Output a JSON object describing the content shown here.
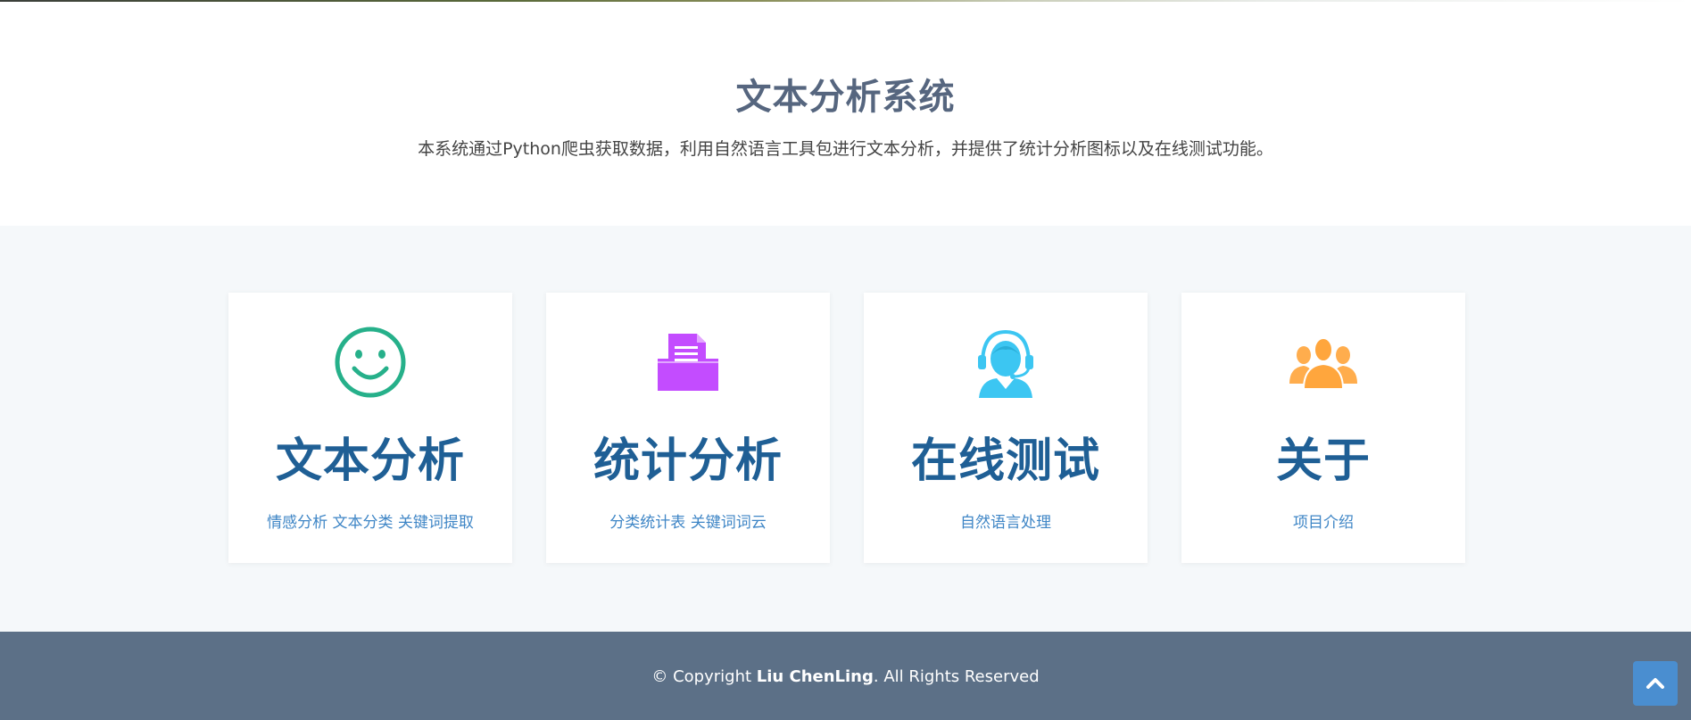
{
  "hero": {
    "title": "文本分析系统",
    "subtitle": "本系统通过Python爬虫获取数据，利用自然语言工具包进行文本分析，并提供了统计分析图标以及在线测试功能。"
  },
  "cards": [
    {
      "icon": "smiley-icon",
      "icon_color": "#26b08a",
      "title": "文本分析",
      "desc": "情感分析 文本分类 关键词提取"
    },
    {
      "icon": "file-tray-icon",
      "icon_color": "#c34cff",
      "title": "统计分析",
      "desc": "分类统计表 关键词词云"
    },
    {
      "icon": "headset-agent-icon",
      "icon_color": "#3cc6f2",
      "title": "在线测试",
      "desc": "自然语言处理"
    },
    {
      "icon": "group-users-icon",
      "icon_color": "#ffad4d",
      "title": "关于",
      "desc": "项目介绍"
    }
  ],
  "footer": {
    "prefix": "© Copyright ",
    "author": "Liu ChenLing",
    "suffix": ". All Rights Reserved"
  },
  "back_to_top": {
    "icon": "chevron-up-icon",
    "color": "#4a8ed0"
  }
}
